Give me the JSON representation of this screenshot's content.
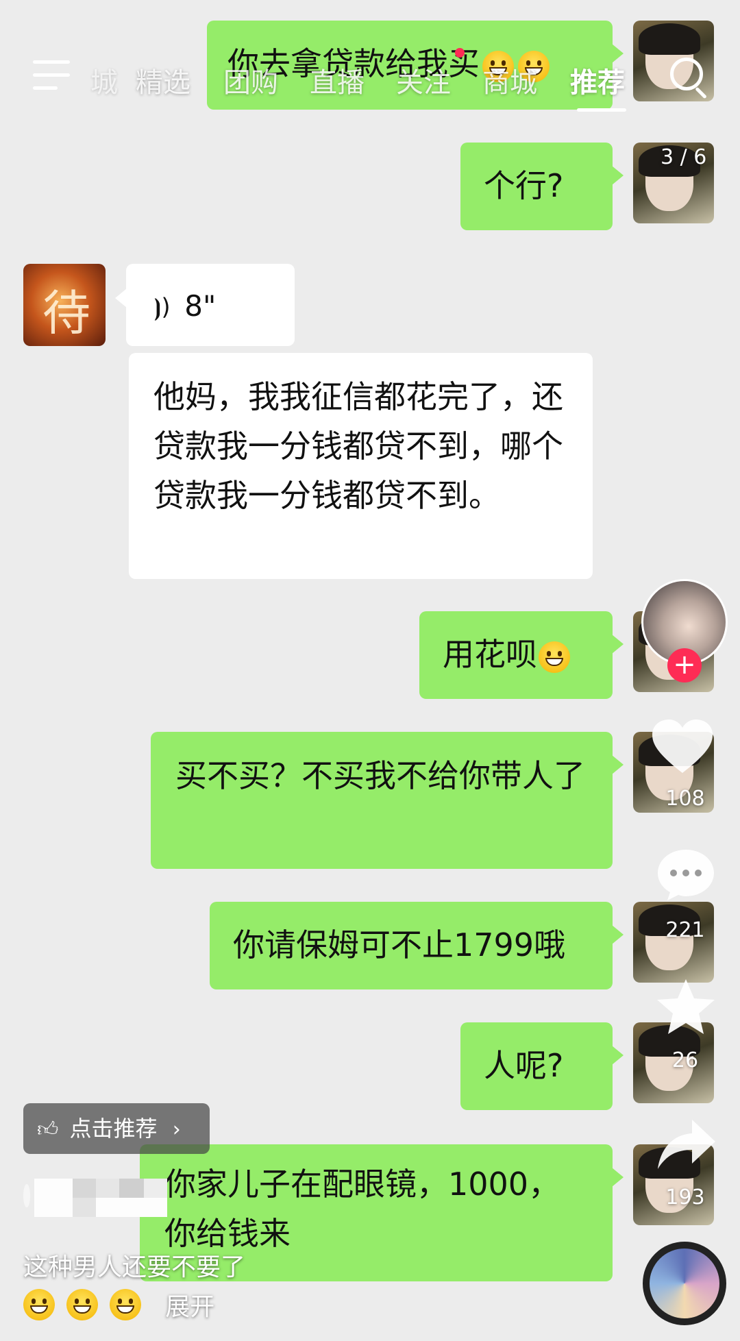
{
  "nav": {
    "tabs": [
      "城",
      "精选",
      "团购",
      "直播",
      "关注",
      "商城",
      "推荐"
    ],
    "active_tab": "推荐"
  },
  "page_indicator": "3 / 6",
  "messages": [
    {
      "from": "me",
      "text": "你去拿贷款给我买"
    },
    {
      "from": "me",
      "text": "个行?"
    },
    {
      "from": "them",
      "type": "voice",
      "text": "8\""
    },
    {
      "from": "them",
      "text": "他妈，我我征信都花完了，还贷款我一分钱都贷不到，哪个贷款我一分钱都贷不到。"
    },
    {
      "from": "me",
      "text": "用花呗"
    },
    {
      "from": "me",
      "text": "买不买？不买我不给你带人了"
    },
    {
      "from": "me",
      "text": "你请保姆可不止1799哦"
    },
    {
      "from": "me",
      "text": "人呢?"
    },
    {
      "from": "me",
      "text": "你家儿子在配眼镜，1000，你给钱来"
    }
  ],
  "rail": {
    "like_count": "108",
    "comment_count": "221",
    "favorite_count": "26",
    "share_count": "193"
  },
  "recommend_button": "点击推荐",
  "caption": {
    "text": "这种男人还要不要了",
    "expand": "展开"
  },
  "colors": {
    "my_bubble": "#95ec69",
    "their_bubble": "#ffffff",
    "follow_plus": "#fe2c55"
  }
}
